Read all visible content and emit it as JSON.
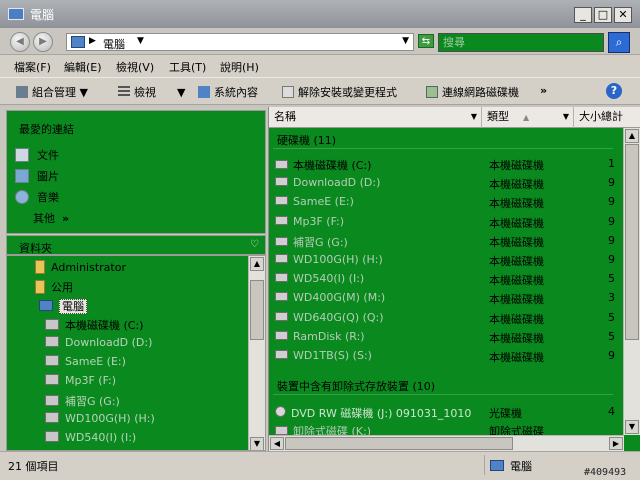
{
  "window": {
    "title": "電腦"
  },
  "address": {
    "location": "電腦",
    "search_placeholder": "搜尋"
  },
  "menu": [
    "檔案(F)",
    "編輯(E)",
    "檢視(V)",
    "工具(T)",
    "說明(H)"
  ],
  "toolbar": {
    "organize": "組合管理",
    "views": "檢視",
    "system_properties": "系統內容",
    "uninstall": "解除安裝或變更程式",
    "map_drive": "連線網路磁碟機",
    "more": "»"
  },
  "favorites": {
    "title": "最愛的連結",
    "items": [
      "文件",
      "圖片",
      "音樂"
    ],
    "more": "其他",
    "more_chev": "»"
  },
  "folders": {
    "title": "資料夾",
    "tree": [
      {
        "label": "Administrator",
        "icon": "folder"
      },
      {
        "label": "公用",
        "icon": "folder"
      },
      {
        "label": "電腦",
        "icon": "computer"
      },
      {
        "label": "本機磁碟機 (C:)",
        "icon": "drive"
      },
      {
        "label": "DownloadD (D:)",
        "icon": "drive"
      },
      {
        "label": "SameE (E:)",
        "icon": "drive"
      },
      {
        "label": "Mp3F (F:)",
        "icon": "drive"
      },
      {
        "label": "補習G (G:)",
        "icon": "drive"
      },
      {
        "label": "WD100G(H) (H:)",
        "icon": "drive"
      },
      {
        "label": "WD540(I) (I:)",
        "icon": "drive"
      }
    ]
  },
  "columns": {
    "name": "名稱",
    "type": "類型",
    "size": "大小總計"
  },
  "groups": {
    "hdd": "硬碟機 (11)",
    "removable": "裝置中含有卸除式存放裝置 (10)"
  },
  "drives": [
    {
      "name": "本機磁碟機 (C:)",
      "type": "本機磁碟機",
      "size": "1"
    },
    {
      "name": "DownloadD (D:)",
      "type": "本機磁碟機",
      "size": "9"
    },
    {
      "name": "SameE (E:)",
      "type": "本機磁碟機",
      "size": "9"
    },
    {
      "name": "Mp3F (F:)",
      "type": "本機磁碟機",
      "size": "9"
    },
    {
      "name": "補習G (G:)",
      "type": "本機磁碟機",
      "size": "9"
    },
    {
      "name": "WD100G(H) (H:)",
      "type": "本機磁碟機",
      "size": "9"
    },
    {
      "name": "WD540(I) (I:)",
      "type": "本機磁碟機",
      "size": "5"
    },
    {
      "name": "WD400G(M) (M:)",
      "type": "本機磁碟機",
      "size": "3"
    },
    {
      "name": "WD640G(Q) (Q:)",
      "type": "本機磁碟機",
      "size": "5"
    },
    {
      "name": "RamDisk (R:)",
      "type": "本機磁碟機",
      "size": "5"
    },
    {
      "name": "WD1TB(S) (S:)",
      "type": "本機磁碟機",
      "size": "9"
    }
  ],
  "removable_items": [
    {
      "name": "DVD RW 磁碟機 (J:) 091031_1010",
      "type": "光碟機",
      "size": "4"
    },
    {
      "name": "卸除式磁碟 (K:)",
      "type": "卸除式磁碟",
      "size": ""
    }
  ],
  "status": {
    "count": "21 個項目",
    "location": "電腦"
  },
  "watermark": "#409493"
}
